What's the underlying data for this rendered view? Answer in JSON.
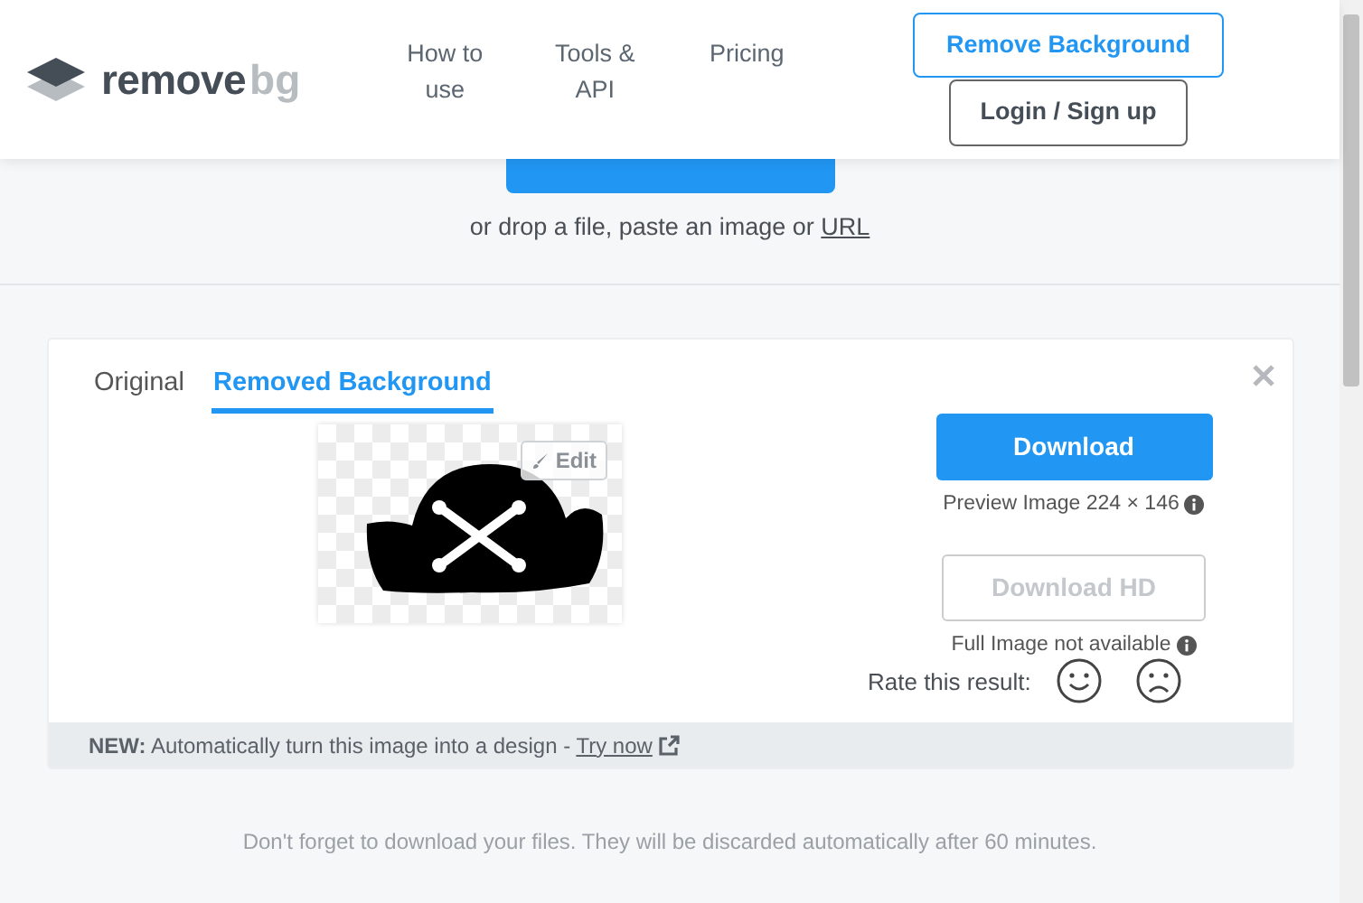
{
  "header": {
    "logo_text": "remove",
    "logo_suffix": "bg",
    "nav": [
      "How to use",
      "Tools & API",
      "Pricing"
    ],
    "buttons": [
      {
        "label": "Remove Background",
        "kind": "primary"
      },
      {
        "label": "Login / Sign up",
        "kind": "secondary"
      }
    ]
  },
  "upload": {
    "hint": "or drop a file, paste an image or",
    "hint_link": "URL"
  },
  "result": {
    "tabs": [
      {
        "label": "Original",
        "selected": false
      },
      {
        "label": "Removed Background",
        "selected": true
      }
    ],
    "edit_button": "Edit",
    "download": {
      "label": "Download",
      "disabled": false
    },
    "preview_note": "Preview Image 224 × 146",
    "download_hd": {
      "label": "Download HD",
      "disabled": true
    },
    "hd_note": "Full Image not available",
    "rate_label": "Rate this result:",
    "banner": {
      "text": "**NEW:** Automatically turn this image into a design -",
      "link": "Try now"
    }
  },
  "footer_note": "Don't forget to download your files. They will be discarded automatically after 60 minutes."
}
